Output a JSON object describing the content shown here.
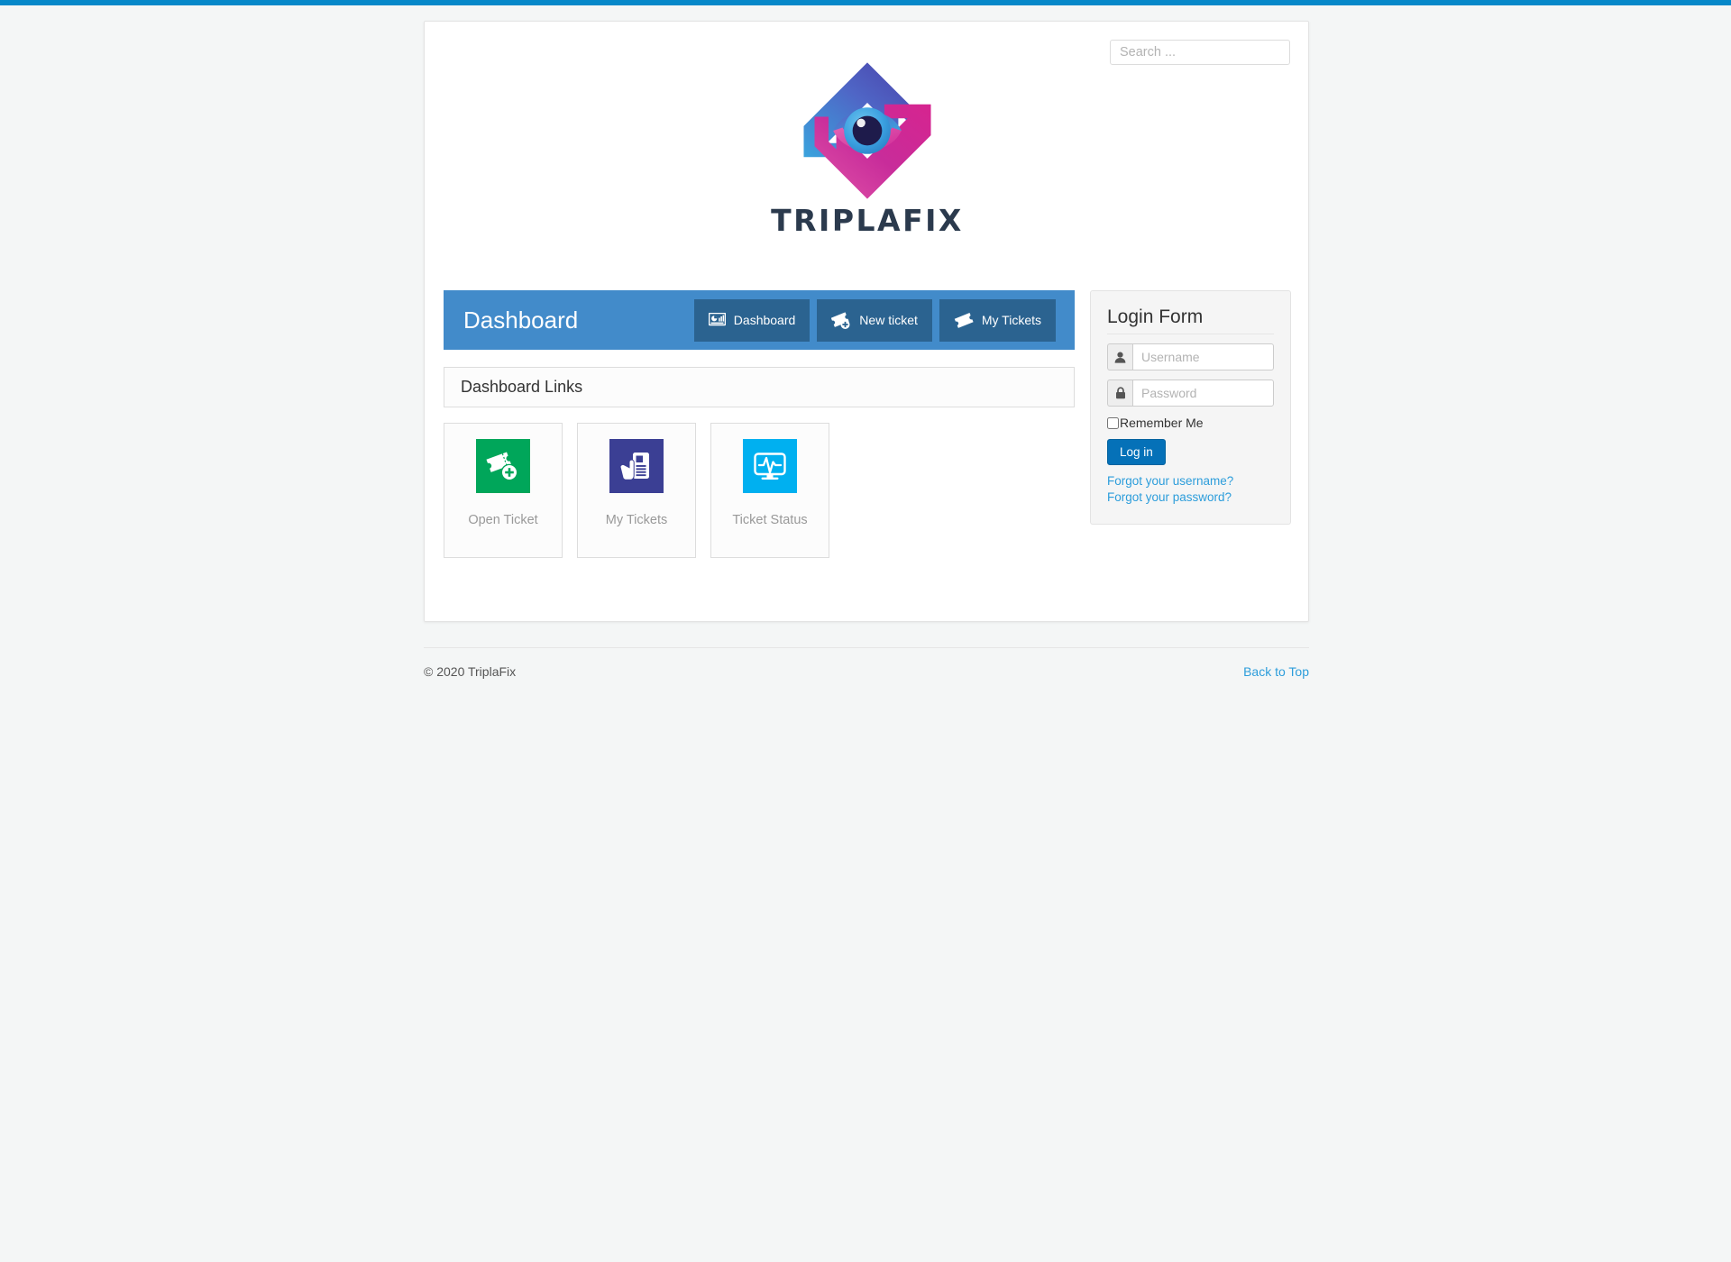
{
  "theme": {
    "top_accent": "#0688c9",
    "header_blue": "#428bca",
    "header_btn_blue": "#2b6390",
    "link_blue": "#2c9ddb",
    "login_btn_blue": "#0571b8",
    "card_green": "#00a65a",
    "card_indigo": "#3b3f94",
    "card_cyan": "#00b0f0",
    "page_bg": "#f4f6f6"
  },
  "search": {
    "placeholder": "Search ...",
    "value": ""
  },
  "brand": {
    "wordmark": "TRIPLAFIX",
    "logo_icon": "triplafix-house-eye-logo"
  },
  "dashboard": {
    "title": "Dashboard",
    "nav": [
      {
        "label": "Dashboard",
        "icon": "chart-monitor-icon"
      },
      {
        "label": "New ticket",
        "icon": "ticket-plus-icon"
      },
      {
        "label": "My Tickets",
        "icon": "ticket-icon"
      }
    ],
    "links_panel_title": "Dashboard Links",
    "cards": [
      {
        "label": "Open Ticket",
        "icon": "ticket-add-icon",
        "color": "#00a65a"
      },
      {
        "label": "My Tickets",
        "icon": "hand-document-icon",
        "color": "#3b3f94"
      },
      {
        "label": "Ticket Status",
        "icon": "monitor-pulse-icon",
        "color": "#00b0f0"
      }
    ]
  },
  "login": {
    "title": "Login Form",
    "username": {
      "placeholder": "Username",
      "value": "",
      "icon": "user-icon"
    },
    "password": {
      "placeholder": "Password",
      "value": "",
      "icon": "lock-icon"
    },
    "remember_label": "Remember Me",
    "remember_checked": false,
    "submit_label": "Log in",
    "forgot_username": "Forgot your username?",
    "forgot_password": "Forgot your password?"
  },
  "footer": {
    "copyright": "© 2020 TriplaFix",
    "back_to_top": "Back to Top"
  }
}
